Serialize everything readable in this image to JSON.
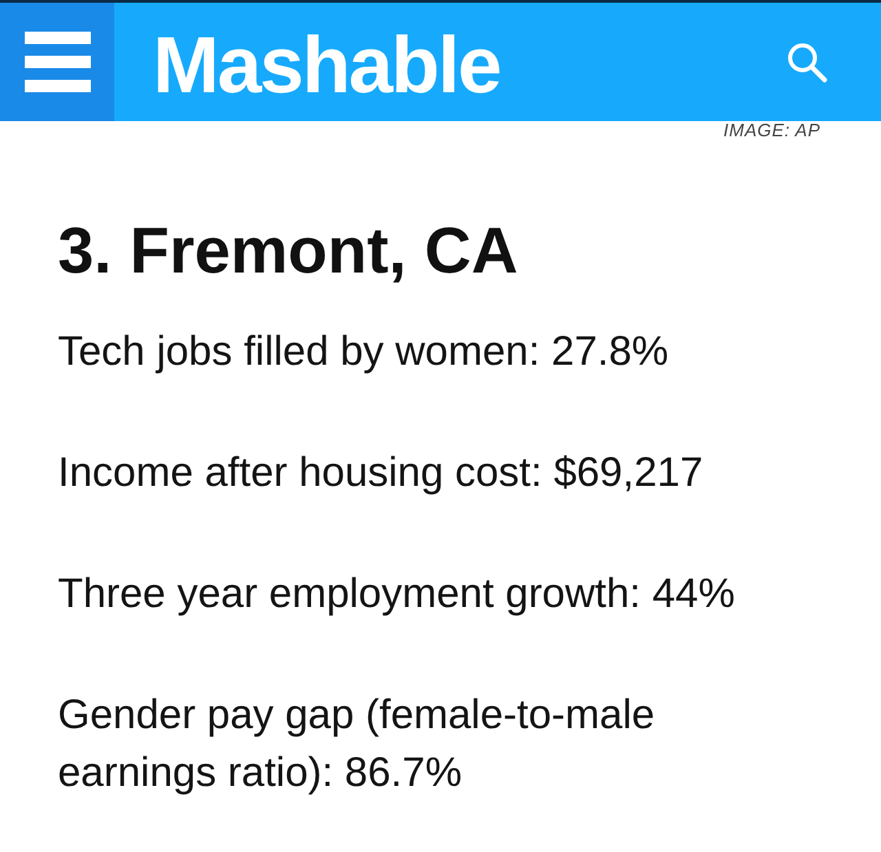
{
  "header": {
    "logo": "Mashable"
  },
  "photo_credit": "IMAGE: AP",
  "article": {
    "heading": "3. Fremont, CA",
    "paragraphs": [
      "Tech jobs filled by women: 27.8%",
      "Income after housing cost: $69,217",
      "Three year employment growth: 44%",
      "Gender pay gap (female-to-male earnings ratio): 86.7%"
    ]
  }
}
